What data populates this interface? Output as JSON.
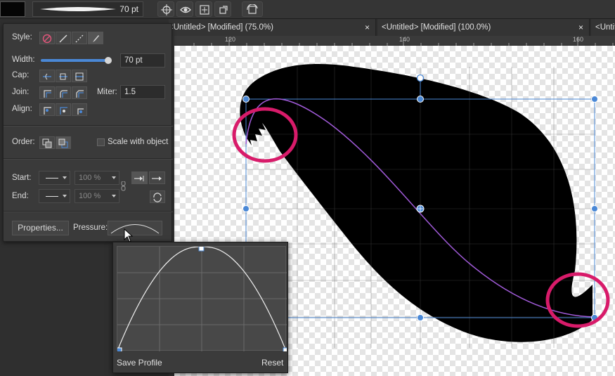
{
  "toolbar": {
    "brush_width_value": "70 pt"
  },
  "tabs": [
    {
      "label": "<Untitled> [Modified] (75.0%)",
      "close": "×"
    },
    {
      "label": "<Untitled> [Modified] (100.0%)",
      "close": "×"
    },
    {
      "label": "<Untitl",
      "close": ""
    }
  ],
  "ruler": {
    "ticks": [
      "120",
      "140",
      "160"
    ]
  },
  "stroke_panel": {
    "style_label": "Style:",
    "width_label": "Width:",
    "width_value": "70 pt",
    "width_slider_level": 0.96,
    "cap_label": "Cap:",
    "join_label": "Join:",
    "miter_label": "Miter:",
    "miter_value": "1.5",
    "align_label": "Align:",
    "order_label": "Order:",
    "scale_with_object_label": "Scale with object",
    "scale_with_object_checked": false,
    "start_label": "Start:",
    "start_scale": "100 %",
    "end_label": "End:",
    "end_scale": "100 %",
    "properties_button": "Properties...",
    "pressure_label": "Pressure:"
  },
  "pressure_popup": {
    "save_profile_button": "Save Profile",
    "reset_button": "Reset"
  },
  "colors": {
    "accent": "#4a88d6",
    "path": "#a05ad8",
    "highlight_circle": "#d81b6a",
    "shape_fill": "#000000"
  }
}
